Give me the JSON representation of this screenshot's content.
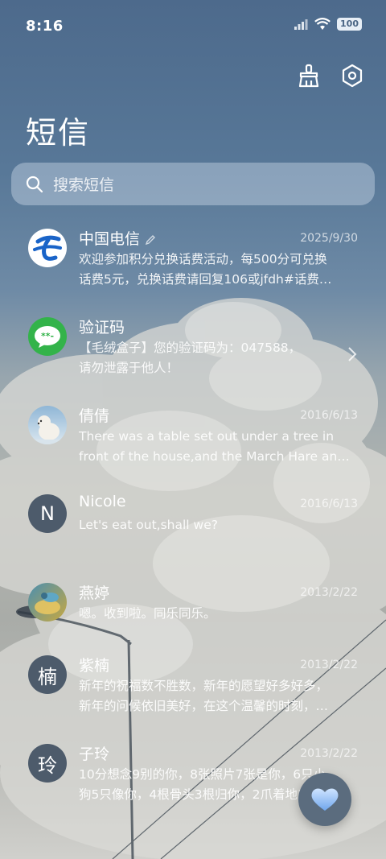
{
  "status": {
    "time": "8:16",
    "battery": "100"
  },
  "header": {
    "title": "短信"
  },
  "search": {
    "placeholder": "搜索短信"
  },
  "conversations": [
    {
      "name": "中国电信",
      "date": "2025/9/30",
      "line1": "欢迎参加积分兑换话费活动，每500分可兑换",
      "line2": "话费5元，兑换话费请回复106或jfdh#话费…",
      "avatar": "china-telecom-logo"
    },
    {
      "name": "验证码",
      "date": "",
      "line1": "【毛绒盒子】您的验证码为：047588，",
      "line2": "请勿泄露于他人！",
      "avatar": "verification-code-icon"
    },
    {
      "name": "倩倩",
      "date": "2016/6/13",
      "line1": "There was a table set out under a tree in",
      "line2": "front of the house,and the March Hare an…",
      "avatar": "polar-bear-photo"
    },
    {
      "name": "Nicole",
      "date": "2016/6/13",
      "line1": "Let's eat out,shall we?",
      "line2": "",
      "avatar_letter": "N"
    },
    {
      "name": "燕婷",
      "date": "2013/2/22",
      "line1": "嗯。收到啦。同乐同乐。",
      "line2": "",
      "avatar": "bird-photo"
    },
    {
      "name": "紫楠",
      "date": "2013/2/22",
      "line1": "新年的祝福数不胜数，新年的愿望好多好多，",
      "line2": "新年的问候依旧美好，在这个温馨的时刻，…",
      "avatar_letter": "楠"
    },
    {
      "name": "子玲",
      "date": "2013/2/22",
      "line1": "10分想念9别的你，8张照片7张是你，6只小",
      "line2": "狗5只像你，4根骨头3根归你，2爪着地1定…",
      "avatar_letter": "玲"
    }
  ],
  "icons": {
    "clean": "broom-icon",
    "settings": "hexagon-settings-icon",
    "fab": "heart-icon"
  }
}
